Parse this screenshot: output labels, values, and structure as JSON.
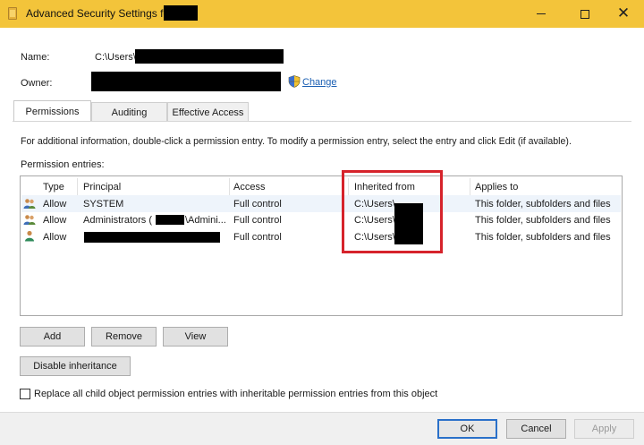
{
  "window": {
    "title": "Advanced Security Settings for"
  },
  "name": {
    "label": "Name:",
    "value": "C:\\Users\\"
  },
  "owner": {
    "label": "Owner:",
    "change_link": "Change"
  },
  "tabs": [
    {
      "label": "Permissions",
      "active": true
    },
    {
      "label": "Auditing",
      "active": false
    },
    {
      "label": "Effective Access",
      "active": false
    }
  ],
  "info_text": "For additional information, double-click a permission entry. To modify a permission entry, select the entry and click Edit (if available).",
  "permission_entries_label": "Permission entries:",
  "columns": {
    "type": "Type",
    "principal": "Principal",
    "access": "Access",
    "inherited_from": "Inherited from",
    "applies_to": "Applies to"
  },
  "rows": [
    {
      "type": "Allow",
      "principal": "SYSTEM",
      "access": "Full control",
      "inherited_from": "C:\\Users\\",
      "applies_to": "This folder, subfolders and files",
      "icon": "users-group-icon"
    },
    {
      "type": "Allow",
      "principal": "Administrators (",
      "principal_suffix": "\\Admini...",
      "access": "Full control",
      "inherited_from": "C:\\Users\\",
      "applies_to": "This folder, subfolders and files",
      "icon": "users-group-icon"
    },
    {
      "type": "Allow",
      "principal": "",
      "access": "Full control",
      "inherited_from": "C:\\Users\\",
      "applies_to": "This folder, subfolders and files",
      "icon": "user-icon"
    }
  ],
  "buttons": {
    "add": "Add",
    "remove": "Remove",
    "view": "View",
    "disable_inheritance": "Disable inheritance",
    "ok": "OK",
    "cancel": "Cancel",
    "apply": "Apply"
  },
  "replace_checkbox": {
    "label": "Replace all child object permission entries with inheritable permission entries from this object",
    "checked": false
  },
  "colors": {
    "titlebar": "#f3c43a",
    "highlight_box": "#d6232b",
    "link": "#1b5fb3"
  }
}
